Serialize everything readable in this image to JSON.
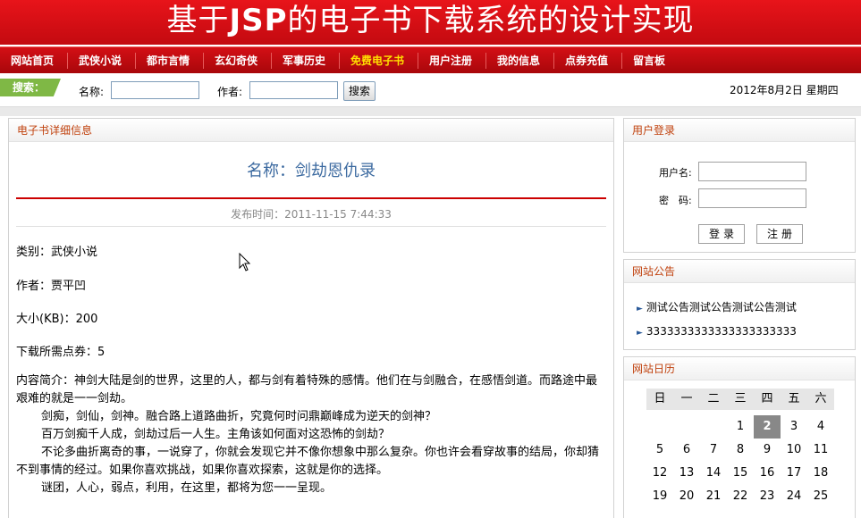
{
  "banner": {
    "title_a": "基于",
    "title_b": "JSP",
    "title_c": "的电子书下载系统的设计实现"
  },
  "nav": {
    "items": [
      {
        "label": "网站首页",
        "active": false
      },
      {
        "label": "武侠小说",
        "active": false
      },
      {
        "label": "都市言情",
        "active": false
      },
      {
        "label": "玄幻奇侠",
        "active": false
      },
      {
        "label": "军事历史",
        "active": false
      },
      {
        "label": "免费电子书",
        "active": true
      },
      {
        "label": "用户注册",
        "active": false
      },
      {
        "label": "我的信息",
        "active": false
      },
      {
        "label": "点券充值",
        "active": false
      },
      {
        "label": "留言板",
        "active": false
      }
    ]
  },
  "search": {
    "tag": "搜索：",
    "name_label": "名称:",
    "name_value": "",
    "author_label": "作者:",
    "author_value": "",
    "button": "搜索",
    "date": "2012年8月2日 星期四"
  },
  "detail": {
    "panel_title": "电子书详细信息",
    "title": "名称：剑劫恩仇录",
    "publish_time": "发布时间：2011-11-15 7:44:33",
    "category": "类别：武侠小说",
    "author": "作者：贾平凹",
    "size": "大小(KB)：200",
    "points": "下载所需点券：5",
    "intro": [
      "内容简介：神剑大陆是剑的世界，这里的人，都与剑有着特殊的感情。他们在与剑融合，在感悟剑道。而路途中最艰难的就是一一剑劫。",
      "剑痴，剑仙，剑神。融合路上道路曲折，究竟何时问鼎巅峰成为逆天的剑神？",
      "百万剑痴千人成，剑劫过后一人生。主角该如何面对这恐怖的剑劫？",
      "不论多曲折离奇的事，一说穿了，你就会发现它并不像你想象中那么复杂。你也许会看穿故事的结局，你却猜不到事情的经过。如果你喜欢挑战，如果你喜欢探索，这就是你的选择。",
      "谜团，人心，弱点，利用，在这里，都将为您一一呈现。"
    ]
  },
  "login": {
    "panel_title": "用户登录",
    "user_label": "用户名:",
    "pass_label": "密　码:",
    "login_button": "登录",
    "register_button": "注册"
  },
  "notices": {
    "panel_title": "网站公告",
    "items": [
      "测试公告测试公告测试公告测试",
      "3333333333333333333333"
    ]
  },
  "calendar": {
    "panel_title": "网站日历",
    "weekdays": [
      "日",
      "一",
      "二",
      "三",
      "四",
      "五",
      "六"
    ],
    "weeks": [
      [
        "",
        "",
        "",
        "1",
        "2",
        "3",
        "4"
      ],
      [
        "5",
        "6",
        "7",
        "8",
        "9",
        "10",
        "11"
      ],
      [
        "12",
        "13",
        "14",
        "15",
        "16",
        "17",
        "18"
      ],
      [
        "19",
        "20",
        "21",
        "22",
        "23",
        "24",
        "25"
      ]
    ],
    "today": "2"
  }
}
